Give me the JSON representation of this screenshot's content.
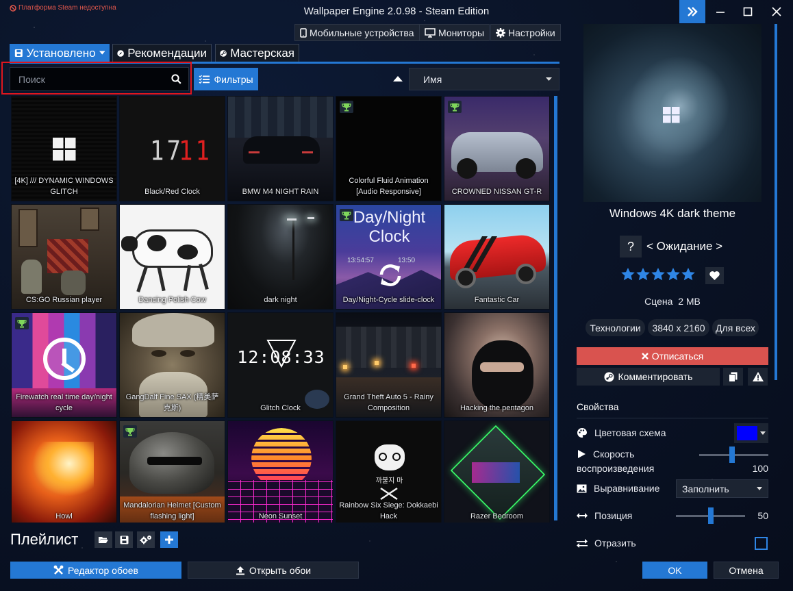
{
  "window": {
    "title": "Wallpaper Engine 2.0.98 - Steam Edition",
    "steam_warning": "Платформа Steam недоступна",
    "accent": "#2478d4"
  },
  "topbar": {
    "mobile": "Мобильные устройства",
    "monitors": "Мониторы",
    "settings": "Настройки"
  },
  "tabs": {
    "installed": "Установлено",
    "recommended": "Рекомендации",
    "workshop": "Мастерская"
  },
  "search": {
    "placeholder": "Поиск",
    "value": ""
  },
  "filters_label": "Фильтры",
  "sort": {
    "selected": "Имя"
  },
  "wallpapers": [
    {
      "title": "[4K] /// DYNAMIC WINDOWS GLITCH",
      "trophy": false
    },
    {
      "title": "Black/Red Clock",
      "trophy": false
    },
    {
      "title": "BMW M4 NIGHT RAIN",
      "trophy": false
    },
    {
      "title": "Colorful Fluid Animation [Audio Responsive]",
      "trophy": true
    },
    {
      "title": "CROWNED NISSAN GT-R",
      "trophy": true
    },
    {
      "title": "CS:GO Russian player",
      "trophy": false
    },
    {
      "title": "Dancing Polish Cow",
      "trophy": false
    },
    {
      "title": "dark night",
      "trophy": false
    },
    {
      "title": "Day/Night-Cycle slide-clock",
      "trophy": true
    },
    {
      "title": "Fantastic Car",
      "trophy": false
    },
    {
      "title": "Firewatch real time day/night cycle",
      "trophy": true
    },
    {
      "title": "GangDalf Fine SAX (精美萨克斯)",
      "trophy": false
    },
    {
      "title": "Glitch Clock",
      "trophy": false
    },
    {
      "title": "Grand Theft Auto 5 - Rainy Composition",
      "trophy": false
    },
    {
      "title": "Hacking the pentagon",
      "trophy": false
    },
    {
      "title": "Howl",
      "trophy": false
    },
    {
      "title": "Mandalorian Helmet [Custom flashing light]",
      "trophy": true
    },
    {
      "title": "Neon Sunset",
      "trophy": false
    },
    {
      "title": "Rainbow Six Siege: Dokkaebi Hack",
      "trophy": false
    },
    {
      "title": "Razer Bedroom",
      "trophy": false
    }
  ],
  "tile_art": {
    "clock1": "17",
    "clock2": "11",
    "daynight_line1": "Day/Night",
    "daynight_line2": "Clock",
    "daynight_time1": "13:54:57",
    "daynight_time2": "13:50",
    "glitch_clock": "12:08:33",
    "dokkaebi": "까불지 마"
  },
  "playlist": {
    "title": "Плейлист"
  },
  "bottom": {
    "editor": "Редактор обоев",
    "open": "Открыть обои",
    "ok": "OK",
    "cancel": "Отмена"
  },
  "details": {
    "title": "Windows 4K dark theme",
    "question": "?",
    "status": "< Ожидание >",
    "rating": 5,
    "type": "Сцена",
    "size": "2 MB",
    "tags": [
      "Технологии",
      "3840 x 2160",
      "Для всех"
    ],
    "unsubscribe": "Отписаться",
    "comment": "Комментировать"
  },
  "properties": {
    "header": "Свойства",
    "color_scheme": {
      "label": "Цветовая схема",
      "color": "#0000ff"
    },
    "speed": {
      "label_line1": "Скорость",
      "label_line2": "воспроизведения",
      "value": "100",
      "fraction": 0.48
    },
    "alignment": {
      "label": "Выравнивание",
      "value": "Заполнить"
    },
    "position": {
      "label": "Позиция",
      "value": "50",
      "fraction": 0.5
    },
    "mirror": {
      "label": "Отразить",
      "checked": false
    }
  }
}
